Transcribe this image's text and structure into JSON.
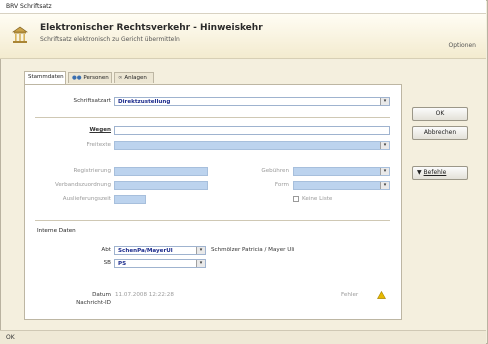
{
  "window": {
    "title": "BRV Schriftsatz"
  },
  "header": {
    "title": "Elektronischer Rechtsverkehr - Hinweiskehr",
    "subtitle": "Schriftsatz elektronisch zu Gericht übermitteln",
    "options_label": "Optionen"
  },
  "tabs": [
    {
      "label": "Stammdaten"
    },
    {
      "label": "Personen"
    },
    {
      "label": "Anlagen"
    }
  ],
  "form": {
    "schriftsatzart": {
      "label": "Schriftsatzart",
      "value": "Direktzustellung"
    },
    "wegen": {
      "label": "Wegen",
      "value": ""
    },
    "freitexte": {
      "label": "Freitexte",
      "value": ""
    },
    "registrierung": {
      "label": "Registrierung"
    },
    "verbandszuordnung": {
      "label": "Verbandszuordnung"
    },
    "auslieferungszeit": {
      "label": "Auslieferungszeit"
    },
    "gebuehren": {
      "label": "Gebühren"
    },
    "form_field": {
      "label": "Form"
    },
    "keine_list": {
      "label": "Keine Liste"
    }
  },
  "internal": {
    "heading": "Interne Daten",
    "abt": {
      "label": "Abt",
      "value": "SchenPa/MayerUl",
      "note": "Schmölzer Patricia / Mayer Uli"
    },
    "sb": {
      "label": "SB",
      "value": "PS"
    },
    "datum": {
      "label": "Datum",
      "value": "11.07.2008 12:22:28"
    },
    "nachricht_id": {
      "label": "Nachricht-ID",
      "value": ""
    },
    "fehler": {
      "label": "Fehler"
    }
  },
  "buttons": {
    "ok": "OK",
    "cancel": "Abbrechen",
    "actions": "Befehle"
  },
  "status": {
    "text": "OK"
  },
  "colors": {
    "accent": "#1a2a8c",
    "header_bg": "#f3ebcf",
    "field_disabled": "#bcd3ee",
    "warning": "#e6b800"
  }
}
